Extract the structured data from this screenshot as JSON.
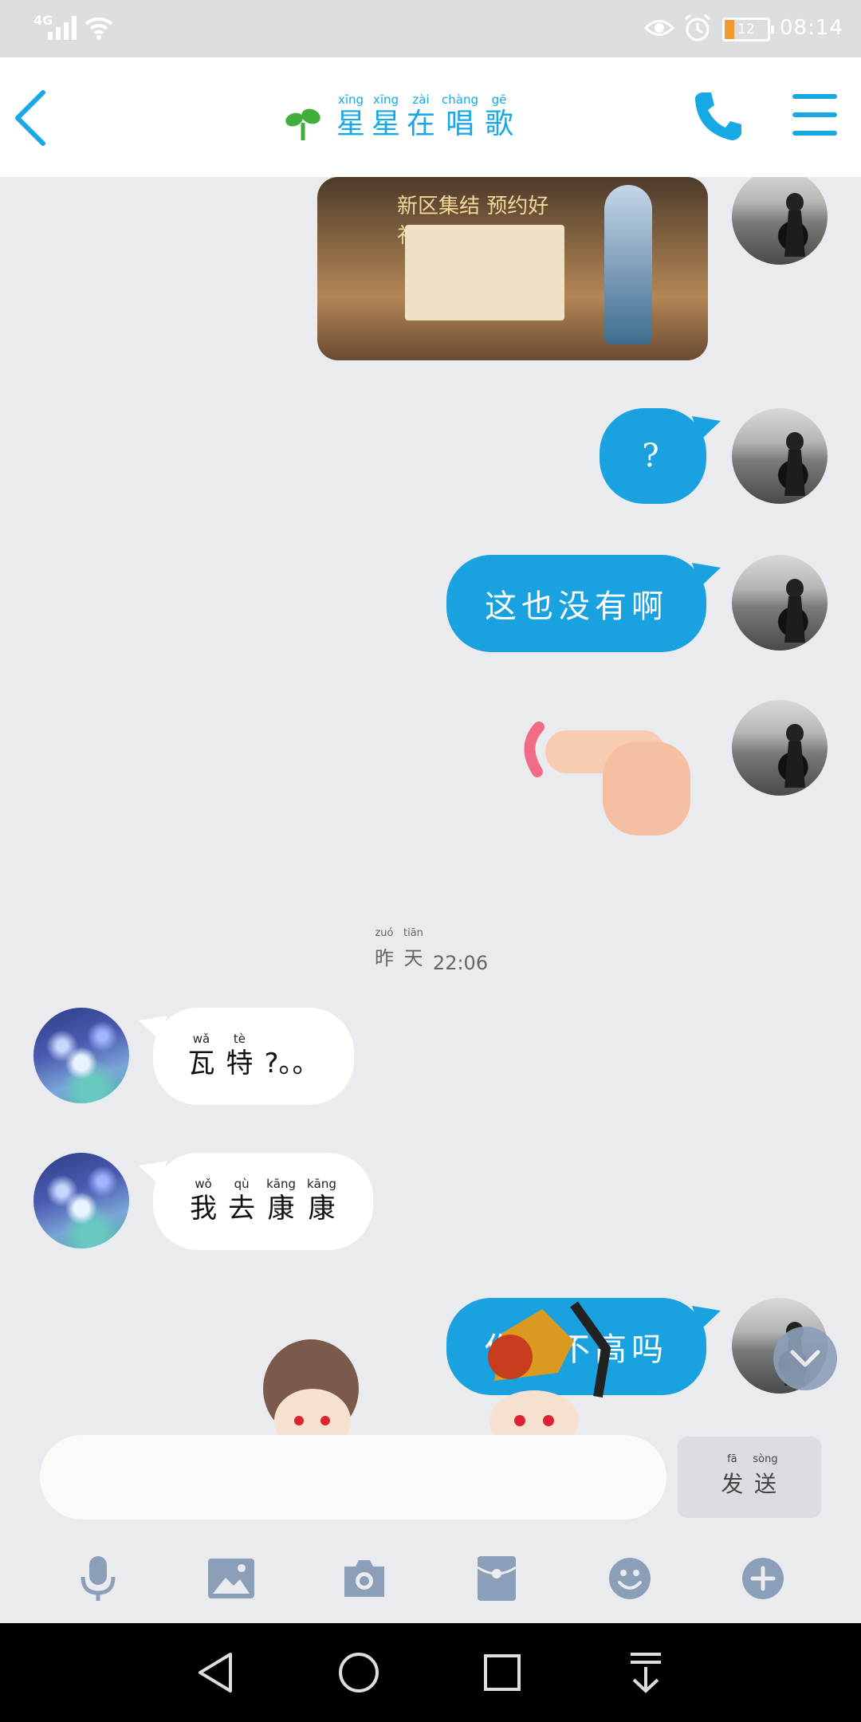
{
  "status_bar": {
    "network": "4G",
    "time": "08:14",
    "battery": "12"
  },
  "header": {
    "title": [
      {
        "py": "xīng",
        "hz": "星"
      },
      {
        "py": "xīng",
        "hz": "星"
      },
      {
        "py": "zài",
        "hz": "在"
      },
      {
        "py": "chàng",
        "hz": "唱"
      },
      {
        "py": "gē",
        "hz": "歌"
      }
    ]
  },
  "game_image": {
    "banner": "新区集结 预约好礼"
  },
  "messages": {
    "m1": "?",
    "m2": "这也没有啊",
    "m7": "你的不高吗"
  },
  "timestamp": {
    "day": [
      {
        "py": "zuó",
        "hz": "昨"
      },
      {
        "py": "tiān",
        "hz": "天"
      }
    ],
    "time": "22:06"
  },
  "incoming": {
    "m5": [
      {
        "py": "wǎ",
        "hz": "瓦"
      },
      {
        "py": "tè",
        "hz": "特"
      }
    ],
    "m5_tail": "?。。",
    "m6": [
      {
        "py": "wǒ",
        "hz": "我"
      },
      {
        "py": "qù",
        "hz": "去"
      },
      {
        "py": "kāng",
        "hz": "康"
      },
      {
        "py": "kāng",
        "hz": "康"
      }
    ]
  },
  "composer": {
    "placeholder": "",
    "send": [
      {
        "py": "fā",
        "hz": "发"
      },
      {
        "py": "sòng",
        "hz": "送"
      }
    ]
  },
  "colors": {
    "accent": "#17a8e6",
    "bubble_out": "#1aa1e0",
    "icon_grey": "#8c9fb9"
  },
  "icons": [
    "back-icon",
    "sprout-icon",
    "phone-icon",
    "menu-icon",
    "microphone-icon",
    "image-icon",
    "camera-icon",
    "red-packet-icon",
    "emoji-icon",
    "plus-icon"
  ]
}
